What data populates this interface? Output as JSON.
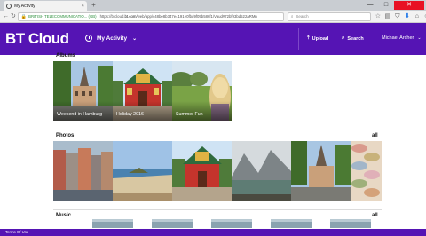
{
  "browser": {
    "tab_title": "My Activity",
    "tab_close": "×",
    "new_tab": "+",
    "window_controls": [
      "—",
      "□",
      "✕"
    ],
    "nav": [
      "←",
      "↻"
    ],
    "url": {
      "lock": "🔒",
      "org": "BRITISH TELECOMMUNICATIO... (GB)",
      "prefix": "https://btcloud.",
      "host": "bt.com",
      "path": "/web/app/c48be8b347e4191e0fbd9f09b586f1/Vaud#72bf93bd522aRMn"
    },
    "search_placeholder": "Search",
    "icons": [
      "star-icon",
      "reading-list-icon",
      "shield-icon",
      "download-icon",
      "home-icon",
      "smiley-icon",
      "menu-icon"
    ],
    "icon_glyphs": [
      "☆",
      "▤",
      "⛉",
      "⬇",
      "⌂",
      "☺",
      "≡"
    ]
  },
  "header": {
    "logo": "BT Cloud",
    "activity_label": "My Activity",
    "upload_label": "Upload",
    "search_label": "Search",
    "user_name": "Michael Archer",
    "brand_color": "#5514b4"
  },
  "albums": {
    "title": "Albums",
    "items": [
      {
        "label": "Weekend in Hamburg",
        "scene": "hamburg"
      },
      {
        "label": "Holiday 2016",
        "scene": "temple"
      },
      {
        "label": "Summer Fun",
        "scene": "park"
      }
    ]
  },
  "photos": {
    "title": "Photos",
    "all_label": "all",
    "items": [
      "houses",
      "beach",
      "temple",
      "lake",
      "hamburg",
      "macarons"
    ]
  },
  "music": {
    "title": "Music",
    "all_label": "all"
  },
  "footer": {
    "terms": "Terms Of Use"
  }
}
